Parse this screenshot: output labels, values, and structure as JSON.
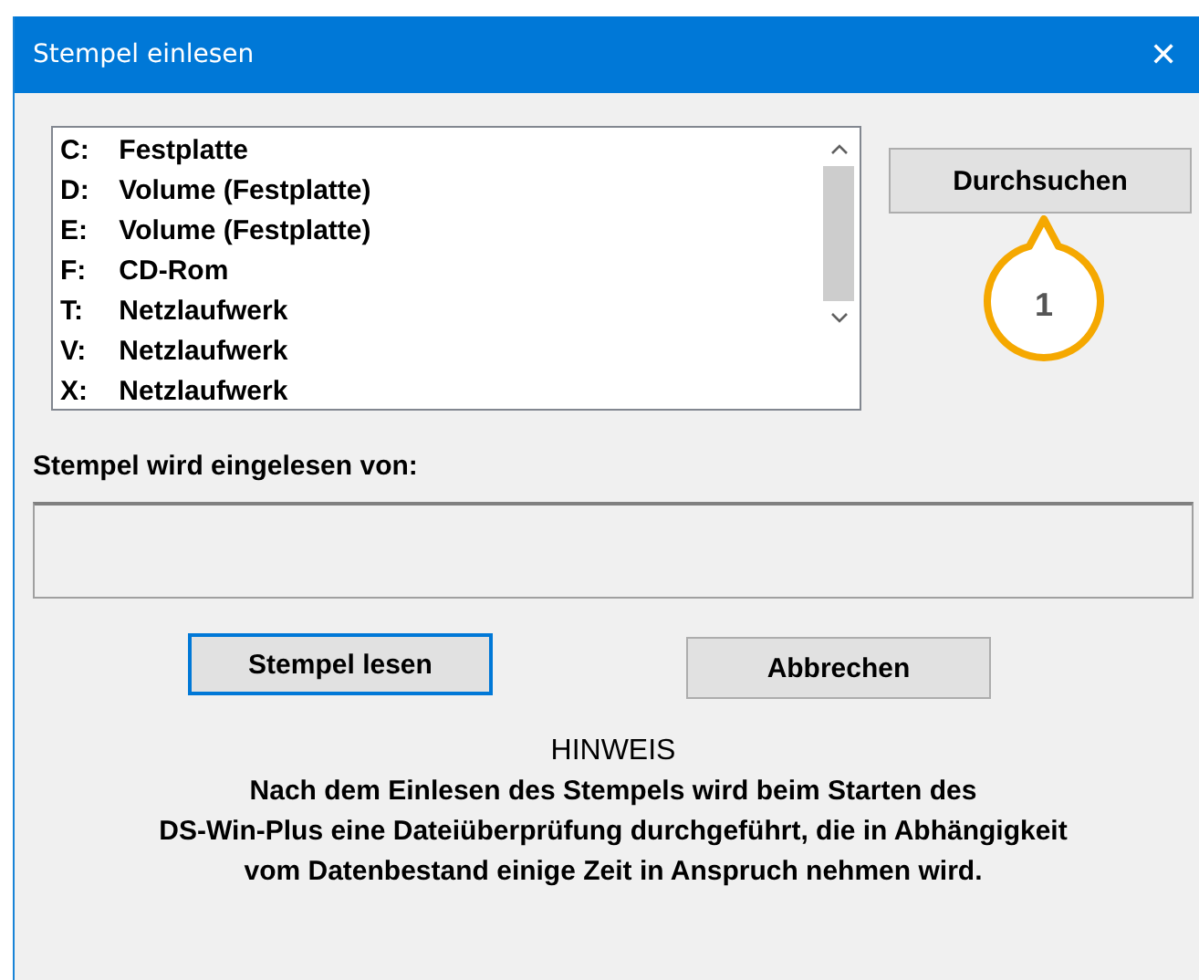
{
  "window": {
    "title": "Stempel einlesen",
    "close": "✕"
  },
  "drives": [
    {
      "letter": "C:",
      "name": "Festplatte"
    },
    {
      "letter": "D:",
      "name": "Volume (Festplatte)"
    },
    {
      "letter": "E:",
      "name": "Volume (Festplatte)"
    },
    {
      "letter": "F:",
      "name": "CD-Rom"
    },
    {
      "letter": "T:",
      "name": "Netzlaufwerk"
    },
    {
      "letter": "V:",
      "name": "Netzlaufwerk"
    },
    {
      "letter": "X:",
      "name": "Netzlaufwerk"
    }
  ],
  "browse_button": "Durchsuchen",
  "callout": "1",
  "source_label": "Stempel wird eingelesen von:",
  "buttons": [
    {
      "label": "Stempel lesen",
      "focused": true
    },
    {
      "label": "Abbrechen",
      "focused": false
    }
  ],
  "notice": {
    "heading": "HINWEIS",
    "lines": [
      "Nach dem Einlesen des Stempels wird beim Starten des",
      "DS-Win-Plus eine Dateiüberprüfung durchgeführt, die in Abhängigkeit",
      "vom Datenbestand einige Zeit in Anspruch nehmen wird."
    ]
  }
}
